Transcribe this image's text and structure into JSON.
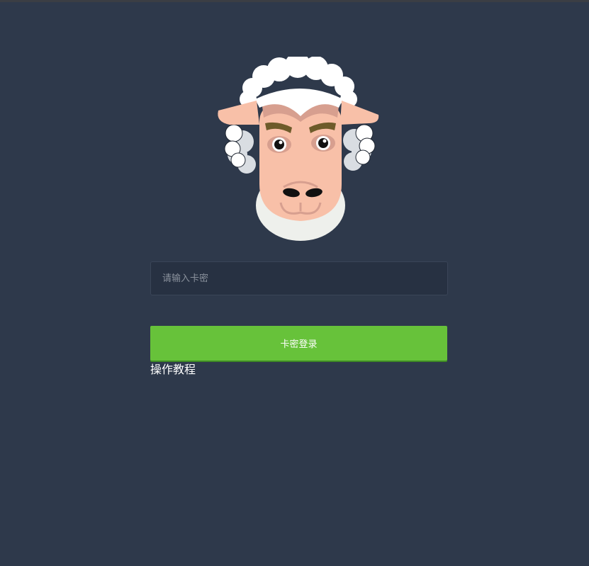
{
  "login": {
    "card_input_placeholder": "请输入卡密",
    "card_input_value": "",
    "login_button_label": "卡密登录",
    "tutorial_link_label": "操作教程"
  },
  "colors": {
    "background": "#2e394b",
    "input_background": "#273142",
    "button_background": "#67c23a",
    "button_text": "#ffffff"
  },
  "icons": {
    "mascot": "sheep-mascot-icon"
  }
}
